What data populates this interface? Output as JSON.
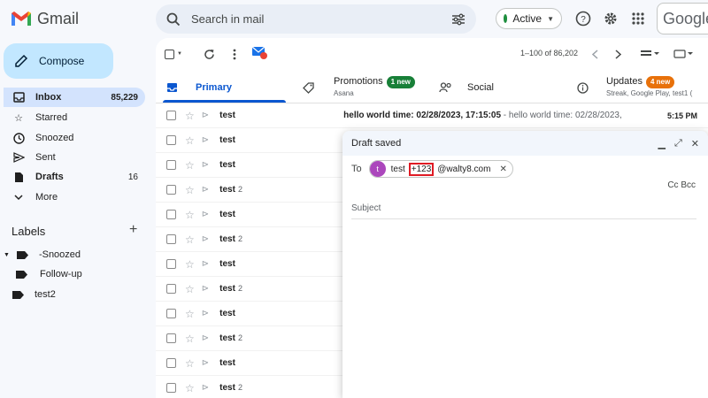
{
  "header": {
    "app_name": "Gmail",
    "search_placeholder": "Search in mail",
    "status_label": "Active",
    "google_text": "Google"
  },
  "sidebar": {
    "compose_label": "Compose",
    "items": [
      {
        "label": "Inbox",
        "count": "85,229",
        "icon": "inbox-icon"
      },
      {
        "label": "Starred",
        "count": "",
        "icon": "star-icon"
      },
      {
        "label": "Snoozed",
        "count": "",
        "icon": "clock-icon"
      },
      {
        "label": "Sent",
        "count": "",
        "icon": "send-icon"
      },
      {
        "label": "Drafts",
        "count": "16",
        "icon": "file-icon"
      },
      {
        "label": "More",
        "count": "",
        "icon": "chevron-down-icon"
      }
    ],
    "labels_title": "Labels",
    "labels": [
      {
        "label": "-Snoozed"
      },
      {
        "label": "Follow-up"
      },
      {
        "label": "test2"
      }
    ]
  },
  "toolbar": {
    "pagination": "1–100 of 86,202"
  },
  "tabs": [
    {
      "label": "Primary",
      "sub": "",
      "badge": ""
    },
    {
      "label": "Promotions",
      "sub": "Asana",
      "badge": "1 new",
      "badge_color": "#188038"
    },
    {
      "label": "Social",
      "sub": "",
      "badge": ""
    },
    {
      "label": "Updates",
      "sub": "Streak, Google Play, test1 (",
      "badge": "4 new",
      "badge_color": "#e8710a"
    }
  ],
  "emails": [
    {
      "sender": "test",
      "num": "",
      "subject": "hello world time: 02/28/2023, 17:15:05",
      "snippet": " - hello world time: 02/28/2023,",
      "time": "5:15 PM"
    },
    {
      "sender": "test",
      "num": ""
    },
    {
      "sender": "test",
      "num": ""
    },
    {
      "sender": "test",
      "num": "2"
    },
    {
      "sender": "test",
      "num": ""
    },
    {
      "sender": "test",
      "num": "2"
    },
    {
      "sender": "test",
      "num": ""
    },
    {
      "sender": "test",
      "num": "2"
    },
    {
      "sender": "test",
      "num": ""
    },
    {
      "sender": "test",
      "num": "2"
    },
    {
      "sender": "test",
      "num": ""
    },
    {
      "sender": "test",
      "num": "2"
    }
  ],
  "draft": {
    "title": "Draft saved",
    "to_label": "To",
    "recipient_avatar": "t",
    "recipient_prefix": "test",
    "recipient_highlight": "+123",
    "recipient_suffix": "@walty8.com",
    "cc_bcc": "Cc Bcc",
    "subject_placeholder": "Subject"
  }
}
